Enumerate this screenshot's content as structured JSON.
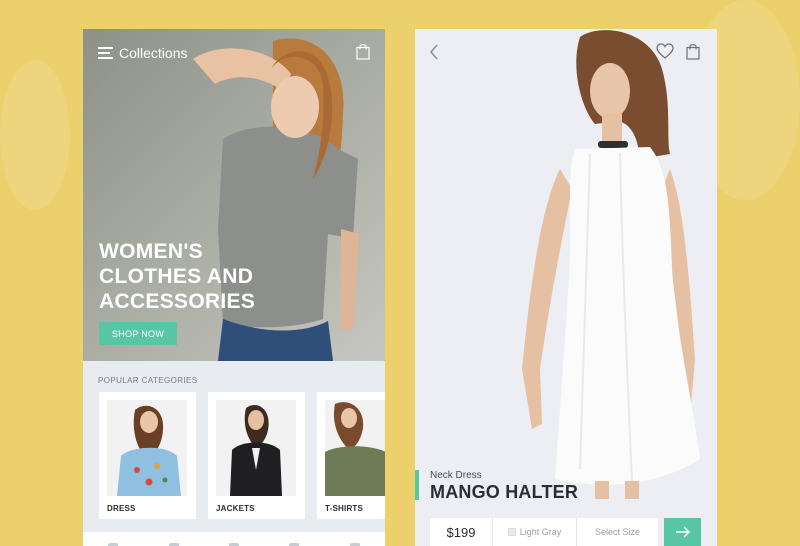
{
  "collections_screen": {
    "header": {
      "title": "Collections",
      "menu_icon": "menu-icon",
      "bag_icon": "shopping-bag-icon"
    },
    "hero": {
      "title_lines": [
        "WOMEN'S",
        "CLOTHES AND",
        "ACCESSORIES"
      ],
      "cta_label": "SHOP NOW"
    },
    "categories": {
      "heading": "POPULAR CATEGORIES",
      "items": [
        {
          "label": "DRESS"
        },
        {
          "label": "JACKETS"
        },
        {
          "label": "T-SHIRTS"
        }
      ]
    }
  },
  "product_screen": {
    "header": {
      "back_icon": "chevron-left-icon",
      "heart_icon": "heart-icon",
      "bag_icon": "shopping-bag-icon"
    },
    "product": {
      "subtitle": "Neck Dress",
      "name": "MANGO HALTER",
      "price": "$199",
      "color_option": "Light Gray",
      "size_placeholder": "Select Size"
    },
    "next_icon": "arrow-right-icon"
  },
  "colors": {
    "accent": "#58c5a5",
    "background": "#ecd06b",
    "text_dark": "#2b2d33"
  }
}
